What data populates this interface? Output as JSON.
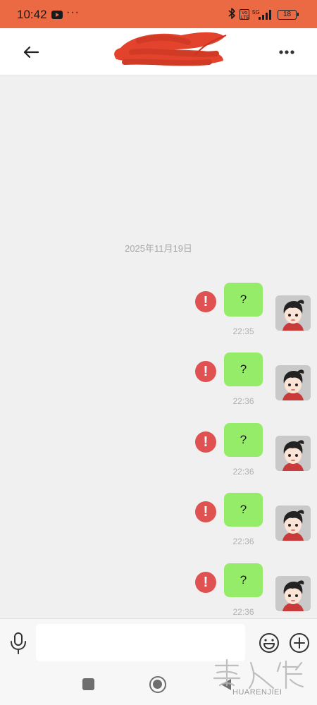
{
  "status_bar": {
    "time": "10:42",
    "dots": "···",
    "volte": "Vo LTE",
    "network": "5G",
    "battery": "18"
  },
  "header": {
    "title_redacted": true,
    "back_icon": "arrow-left-icon",
    "more_icon": "more-horizontal-icon"
  },
  "chat": {
    "date": "2025年11月19日",
    "messages": [
      {
        "text": "?",
        "time": "22:35",
        "status": "failed"
      },
      {
        "text": "?",
        "time": "22:36",
        "status": "failed"
      },
      {
        "text": "?",
        "time": "22:36",
        "status": "failed"
      },
      {
        "text": "?",
        "time": "22:36",
        "status": "failed"
      },
      {
        "text": "?",
        "time": "22:36",
        "status": "failed"
      }
    ],
    "error_glyph": "!"
  },
  "input_bar": {
    "placeholder": "",
    "value": "",
    "voice_icon": "microphone-icon",
    "emoji_icon": "smiley-icon",
    "add_icon": "plus-circle-icon"
  },
  "watermark": {
    "romanized": "HUARENJIEI"
  },
  "colors": {
    "status_bar": "#ec6a43",
    "bubble": "#95ec69",
    "error": "#e05151",
    "redaction": "#e3432c"
  }
}
